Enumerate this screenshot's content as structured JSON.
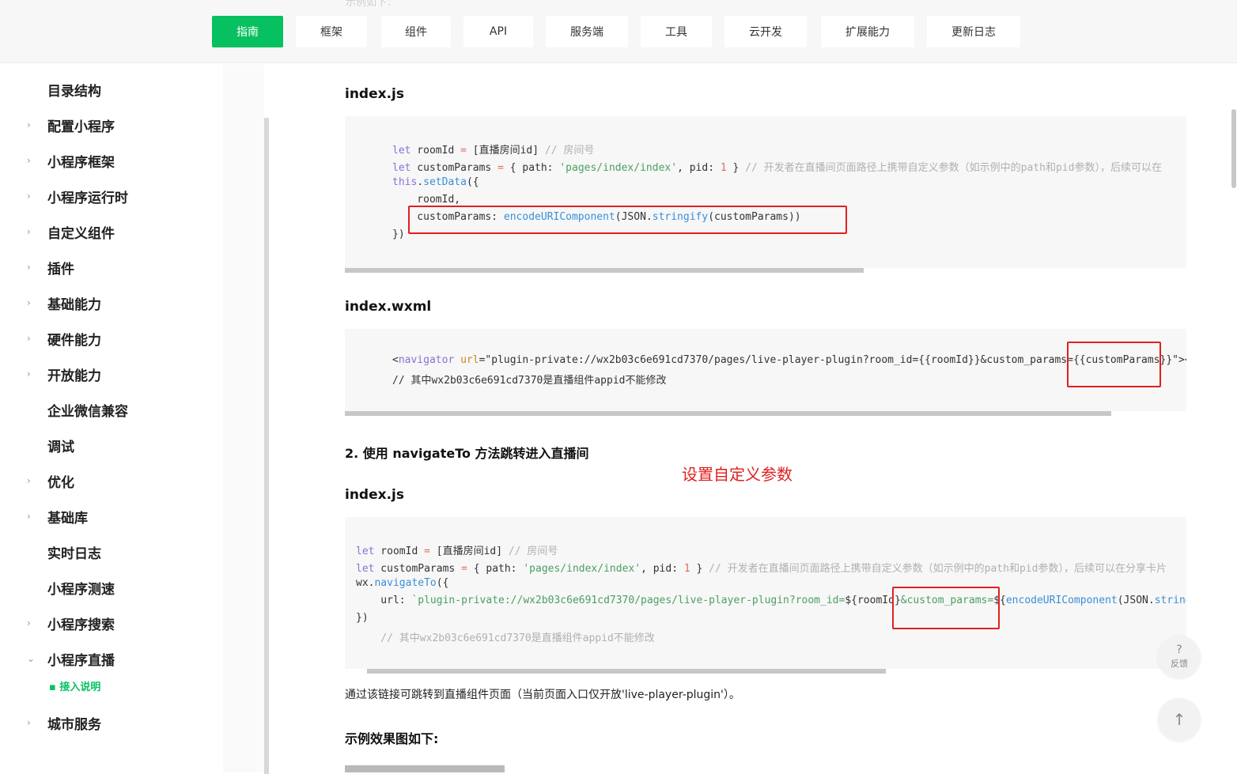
{
  "nav": {
    "ghost_text": "示例如下：",
    "tabs": [
      {
        "label": "指南",
        "active": true
      },
      {
        "label": "框架"
      },
      {
        "label": "组件"
      },
      {
        "label": "API"
      },
      {
        "label": "服务端"
      },
      {
        "label": "工具"
      },
      {
        "label": "云开发"
      },
      {
        "label": "扩展能力"
      },
      {
        "label": "更新日志"
      }
    ],
    "accent": "#07c160"
  },
  "sidebar": {
    "items": [
      {
        "label": "目录结构",
        "chevron": ""
      },
      {
        "label": "配置小程序",
        "chevron": "›"
      },
      {
        "label": "小程序框架",
        "chevron": "›"
      },
      {
        "label": "小程序运行时",
        "chevron": "›"
      },
      {
        "label": "自定义组件",
        "chevron": "›"
      },
      {
        "label": "插件",
        "chevron": "›"
      },
      {
        "label": "基础能力",
        "chevron": "›"
      },
      {
        "label": "硬件能力",
        "chevron": "›"
      },
      {
        "label": "开放能力",
        "chevron": "›"
      },
      {
        "label": "企业微信兼容",
        "chevron": ""
      },
      {
        "label": "调试",
        "chevron": ""
      },
      {
        "label": "优化",
        "chevron": "›"
      },
      {
        "label": "基础库",
        "chevron": "›"
      },
      {
        "label": "实时日志",
        "chevron": ""
      },
      {
        "label": "小程序测速",
        "chevron": ""
      },
      {
        "label": "小程序搜索",
        "chevron": "›"
      },
      {
        "label": "小程序直播",
        "chevron": "⌄"
      },
      {
        "label": "城市服务",
        "chevron": "›"
      }
    ],
    "sub_item": "▪ 接入说明"
  },
  "content": {
    "h_index_js_1": "index.js",
    "h_index_wxml": "index.wxml",
    "h_navigate": "2. 使用 navigateTo 方法跳转进入直播间",
    "h_index_js_2": "index.js",
    "annotation": "设置自定义参数",
    "para": "通过该链接可跳转到直播组件页面（当前页面入口仅开放'live-player-plugin'）。",
    "h_example": "示例效果图如下:",
    "code1": {
      "l1_kw": "let",
      "l1_var": " roomId ",
      "l1_op": "=",
      "l1_val": " [直播房间id] ",
      "l1_cm": "// 房间号",
      "l2_kw": "let",
      "l2_var": " customParams ",
      "l2_op": "=",
      "l2_a": " { path: ",
      "l2_str": "'pages/index/index'",
      "l2_b": ", pid: ",
      "l2_num": "1",
      "l2_c": " } ",
      "l2_cm": "// 开发者在直播间页面路径上携带自定义参数（如示例中的path和pid参数），后续可以在",
      "l3_kw": "this",
      "l3_dot": ".",
      "l3_fn": "setData",
      "l3_rest": "({",
      "l4": "    roomId,",
      "l5_a": "    customParams: ",
      "l5_fn": "encodeURIComponent",
      "l5_b": "(JSON.",
      "l5_fn2": "stringify",
      "l5_c": "(customParams))",
      "l6": "})"
    },
    "code2": {
      "l1_lt": "<",
      "l1_tag": "navigator",
      "l1_sp": " ",
      "l1_attr": "url",
      "l1_val": "=\"plugin-private://wx2b03c6e691cd7370/pages/live-player-plugin?room_id={{roomId}}&custom_params={{customParams}}\"></n",
      "l2": "// 其中wx2b03c6e691cd7370是直播组件appid不能修改"
    },
    "code3": {
      "l1_kw": "let",
      "l1_var": " roomId ",
      "l1_op": "=",
      "l1_val": " [直播房间id] ",
      "l1_cm": "// 房间号",
      "l2_kw": "let",
      "l2_var": " customParams ",
      "l2_op": "=",
      "l2_a": " { path: ",
      "l2_str": "'pages/index/index'",
      "l2_b": ", pid: ",
      "l2_num": "1",
      "l2_c": " } ",
      "l2_cm": "// 开发者在直播间页面路径上携带自定义参数（如示例中的path和pid参数），后续可以在分享卡片",
      "l3_a": "wx.",
      "l3_fn": "navigateTo",
      "l3_b": "({",
      "l4_a": "    url: ",
      "l4_str": "`plugin-private://wx2b03c6e691cd7370/pages/live-player-plugin?room_id=",
      "l4_b": "${roomId}",
      "l4_str2": "&custom_params=",
      "l4_c": "${",
      "l4_fn": "encodeURIComponent",
      "l4_d": "(JSON.",
      "l4_fn2": "stringify",
      "l5": "})",
      "l6_cm": "    // 其中wx2b03c6e691cd7370是直播组件appid不能修改"
    }
  },
  "fab": {
    "feedback_symbol": "?",
    "feedback_label": "反馈",
    "top_symbol": "↑"
  }
}
